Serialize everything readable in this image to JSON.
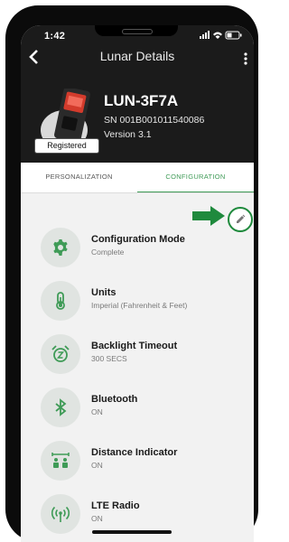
{
  "status": {
    "time": "1:42"
  },
  "appbar": {
    "back_icon": "chevron-left-icon",
    "title": "Lunar Details",
    "more_icon": "vertical-dots-icon"
  },
  "device": {
    "name": "LUN-3F7A",
    "serial": "SN 001B001011540086",
    "version": "Version 3.1",
    "badge": "Registered"
  },
  "tabs": [
    {
      "label": "PERSONALIZATION",
      "active": false
    },
    {
      "label": "CONFIGURATION",
      "active": true
    }
  ],
  "accent": "#3f9b57",
  "edit_icon": "pencil-icon",
  "items": [
    {
      "title": "Configuration Mode",
      "subtitle": "Complete",
      "icon": "gear-icon"
    },
    {
      "title": "Units",
      "subtitle": "Imperial (Fahrenheit & Feet)",
      "icon": "thermometer-icon"
    },
    {
      "title": "Backlight Timeout",
      "subtitle": "300 SECS",
      "icon": "alarm-clock-icon"
    },
    {
      "title": "Bluetooth",
      "subtitle": "ON",
      "icon": "bluetooth-icon"
    },
    {
      "title": "Distance Indicator",
      "subtitle": "ON",
      "icon": "distance-people-icon"
    },
    {
      "title": "LTE Radio",
      "subtitle": "ON",
      "icon": "radio-signal-icon"
    }
  ]
}
